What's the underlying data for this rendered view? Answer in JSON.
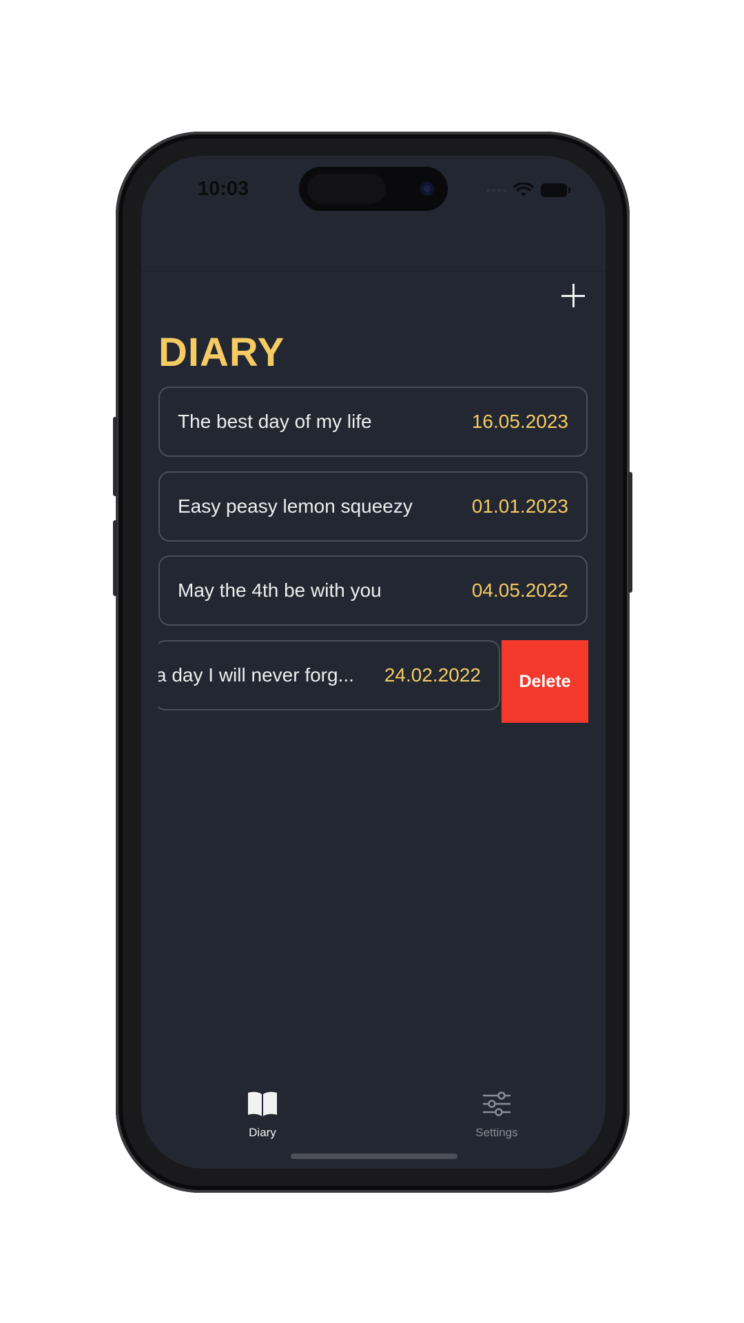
{
  "status_bar": {
    "time": "10:03"
  },
  "header": {
    "add_icon": "plus-icon"
  },
  "page": {
    "title": "DIARY"
  },
  "entries": [
    {
      "title": "The best day of my life",
      "date": "16.05.2023"
    },
    {
      "title": "Easy peasy lemon squeezy",
      "date": "01.01.2023"
    },
    {
      "title": "May the 4th be with you",
      "date": "04.05.2022"
    },
    {
      "title": "a day I will never forg...",
      "date": "24.02.2022",
      "swiped": true
    }
  ],
  "swipe_actions": {
    "delete_label": "Delete"
  },
  "tab_bar": {
    "tabs": [
      {
        "label": "Diary",
        "icon": "book-icon",
        "active": true
      },
      {
        "label": "Settings",
        "icon": "sliders-icon",
        "active": false
      }
    ]
  },
  "colors": {
    "background": "#222731",
    "accent": "#f6cb64",
    "text": "#eeeeee",
    "delete": "#f3392c",
    "border": "#4a4f59",
    "inactive_tab": "#8a8e96"
  }
}
